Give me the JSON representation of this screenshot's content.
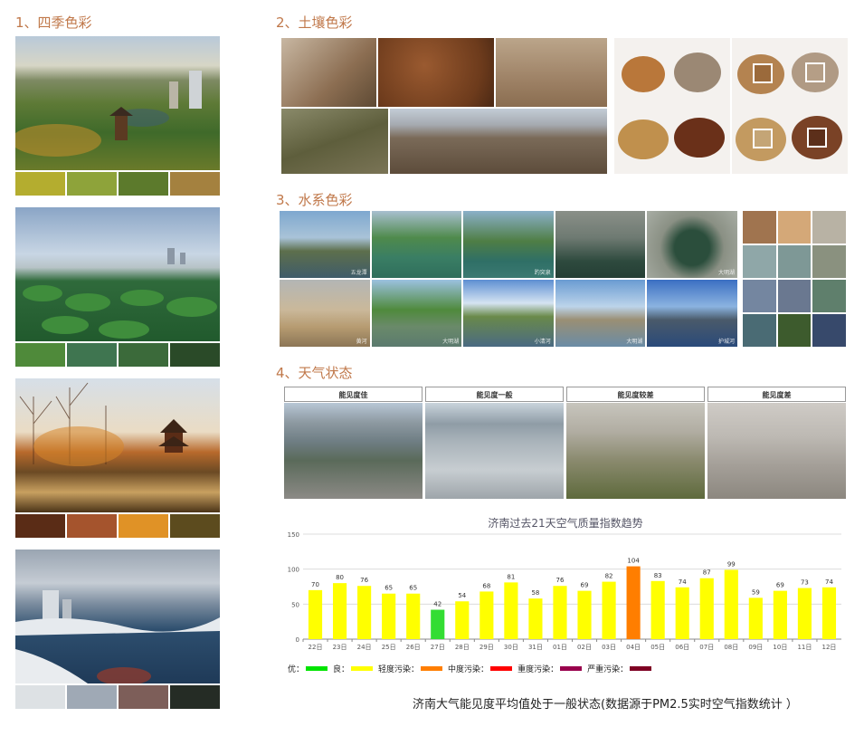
{
  "sections": {
    "season": "1、四季色彩",
    "soil": "2、土壤色彩",
    "water": "3、水系色彩",
    "weather": "4、天气状态"
  },
  "seasons": [
    {
      "name": "spring",
      "swatches": [
        "#b4ad2f",
        "#8ea33a",
        "#5c7a2c",
        "#a4813f"
      ]
    },
    {
      "name": "summer",
      "swatches": [
        "#4f8a3a",
        "#3f7550",
        "#3b6a3a",
        "#2a4a28"
      ]
    },
    {
      "name": "autumn",
      "swatches": [
        "#5a2c16",
        "#a5542d",
        "#e09226",
        "#5c4b1e"
      ]
    },
    {
      "name": "winter",
      "swatches": [
        "#dde1e4",
        "#9fa9b5",
        "#7d5e59",
        "#252c25"
      ]
    }
  ],
  "soil_swatches": [
    "#9b6a3b",
    "#b59e86",
    "#c4a576",
    "#5c2f1a"
  ],
  "water": {
    "captions": [
      "五龙潭",
      "",
      "趵突泉",
      "",
      "大明湖",
      "黄河",
      "大明湖",
      "小清河",
      "大明湖",
      "护城河"
    ],
    "swatches": [
      "#a0744f",
      "#d4a878",
      "#b8b2a4",
      "#8fa7a8",
      "#7e9896",
      "#8a917f",
      "#7486a0",
      "#6a7890",
      "#5f7f6c",
      "#4a6b74",
      "#3d5b2d",
      "#37496b"
    ]
  },
  "weather": {
    "labels": [
      "能见度佳",
      "能见度一般",
      "能见度较差",
      "能见度差"
    ]
  },
  "chart_data": {
    "type": "bar",
    "title": "济南过去21天空气质量指数趋势",
    "categories": [
      "22日",
      "23日",
      "24日",
      "25日",
      "26日",
      "27日",
      "28日",
      "29日",
      "30日",
      "31日",
      "01日",
      "02日",
      "03日",
      "04日",
      "05日",
      "06日",
      "07日",
      "08日",
      "09日",
      "10日",
      "11日",
      "12日"
    ],
    "values": [
      70,
      80,
      76,
      65,
      65,
      42,
      54,
      68,
      81,
      58,
      76,
      69,
      82,
      104,
      83,
      74,
      87,
      99,
      59,
      69,
      73,
      74
    ],
    "ylim": [
      0,
      150
    ],
    "yticks": [
      0,
      50,
      100,
      150
    ],
    "colors": {
      "good": "#33dd33",
      "mild": "#ffff00",
      "moderate": "#ff7e00"
    },
    "legend": [
      {
        "label": "优：",
        "color": "#00e400"
      },
      {
        "label": "良：",
        "color": "#ffff00"
      },
      {
        "label": "轻度污染：",
        "color": "#ff7e00"
      },
      {
        "label": "中度污染：",
        "color": "#ff0000"
      },
      {
        "label": "重度污染：",
        "color": "#99004c"
      },
      {
        "label": "严重污染：",
        "color": "#7e0023"
      }
    ]
  },
  "footnote": "济南大气能见度平均值处于一般状态(数据源于PM2.5实时空气指数统计 ）"
}
